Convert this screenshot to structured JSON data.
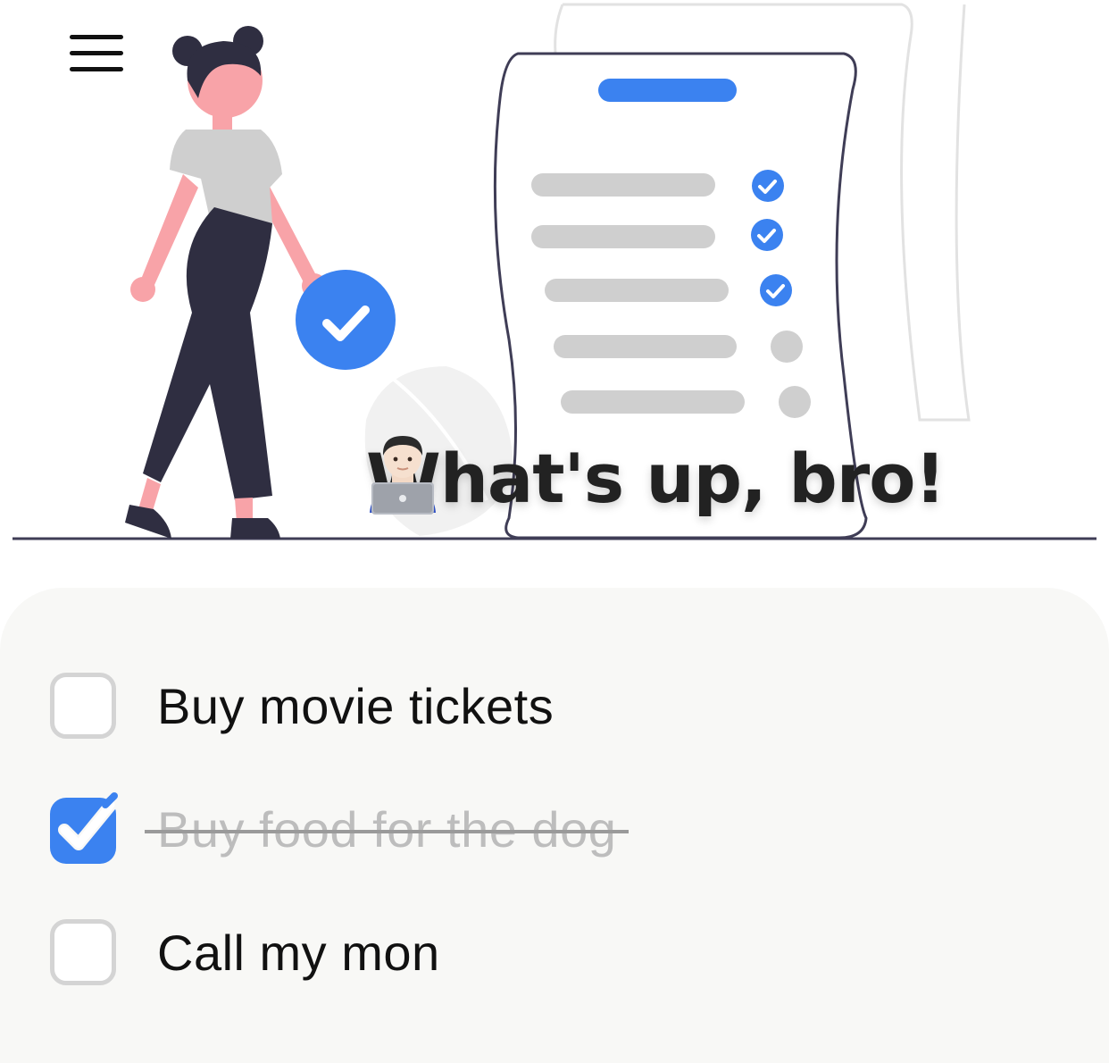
{
  "header": {
    "menu_icon": "hamburger-menu-icon",
    "greeting": "What's up, bro!",
    "greeting_emoji": "technologist-emoji",
    "illustration": "woman-with-checklist-illustration"
  },
  "tasks": [
    {
      "label": "Buy movie tickets",
      "done": false
    },
    {
      "label": "Buy food for the dog",
      "done": true
    },
    {
      "label": "Call my mon",
      "done": false
    }
  ],
  "colors": {
    "accent": "#3b82f0",
    "ink": "#2f2e41",
    "skin": "#f8a3a8",
    "panel": "#f8f8f6"
  }
}
